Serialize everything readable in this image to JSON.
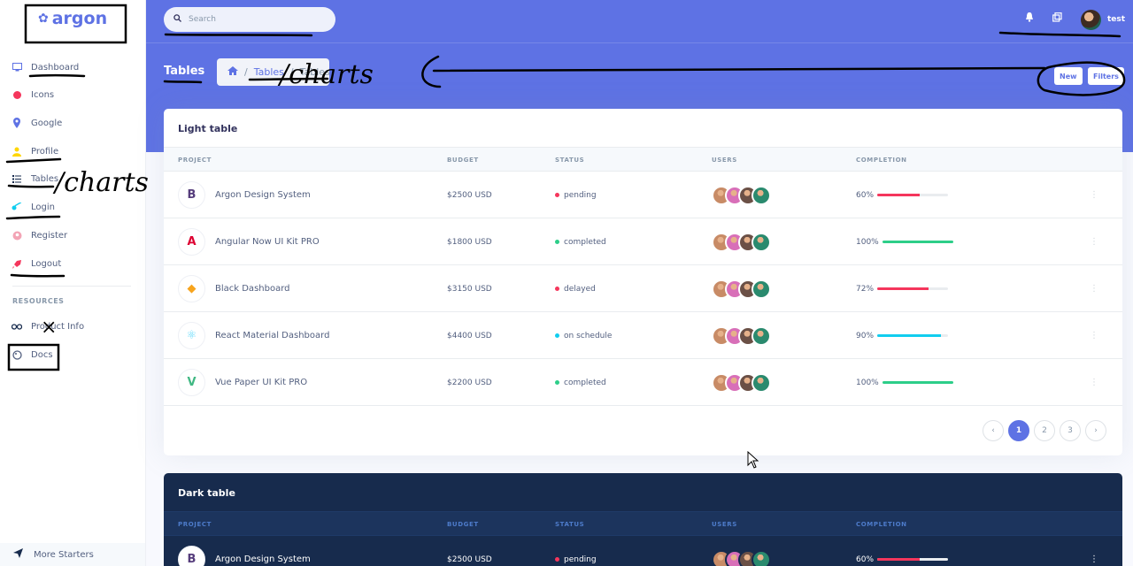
{
  "brand": {
    "name": "argon"
  },
  "sidebar": {
    "items": [
      {
        "label": "Dashboard",
        "icon": "monitor-icon",
        "color": "#5e72e4"
      },
      {
        "label": "Icons",
        "icon": "planet-icon",
        "color": "#f5365c"
      },
      {
        "label": "Google",
        "icon": "pin-icon",
        "color": "#5e72e4"
      },
      {
        "label": "Profile",
        "icon": "user-icon",
        "color": "#ffd600"
      },
      {
        "label": "Tables",
        "icon": "bullet-list-icon",
        "color": "#172b4d"
      },
      {
        "label": "Login",
        "icon": "key-icon",
        "color": "#11cdef"
      },
      {
        "label": "Register",
        "icon": "circle-user-icon",
        "color": "#f3a4b5"
      },
      {
        "label": "Logout",
        "icon": "rocket-icon",
        "color": "#f5365c"
      }
    ],
    "resources_heading": "RESOURCES",
    "resources": [
      {
        "label": "Product Info",
        "icon": "glasses-icon"
      },
      {
        "label": "Docs",
        "icon": "palette-icon"
      }
    ],
    "more_starters": "More Starters"
  },
  "header": {
    "search_placeholder": "Search",
    "user_name": "test",
    "page_title": "Tables",
    "breadcrumb": {
      "sep": "/",
      "link": "Tables",
      "active": "Tables"
    },
    "btn_new": "New",
    "btn_filters": "Filters"
  },
  "light_table": {
    "title": "Light table",
    "columns": [
      "PROJECT",
      "BUDGET",
      "STATUS",
      "USERS",
      "COMPLETION"
    ],
    "rows": [
      {
        "logo": "B",
        "logo_color": "#563d7c",
        "project": "Argon Design System",
        "budget": "$2500 USD",
        "status": "pending",
        "status_color": "#f5365c",
        "completion_label": "60%",
        "completion": 0.6,
        "bar_color": "#f5365c"
      },
      {
        "logo": "A",
        "logo_color": "#dd0031",
        "project": "Angular Now UI Kit PRO",
        "budget": "$1800 USD",
        "status": "completed",
        "status_color": "#2dce89",
        "completion_label": "100%",
        "completion": 1.0,
        "bar_color": "#2dce89"
      },
      {
        "logo": "◆",
        "logo_color": "#f7a41d",
        "project": "Black Dashboard",
        "budget": "$3150 USD",
        "status": "delayed",
        "status_color": "#f5365c",
        "completion_label": "72%",
        "completion": 0.72,
        "bar_color": "#f5365c"
      },
      {
        "logo": "⚛",
        "logo_color": "#61dafb",
        "project": "React Material Dashboard",
        "budget": "$4400 USD",
        "status": "on schedule",
        "status_color": "#11cdef",
        "completion_label": "90%",
        "completion": 0.9,
        "bar_color": "#11cdef"
      },
      {
        "logo": "V",
        "logo_color": "#41b883",
        "project": "Vue Paper UI Kit PRO",
        "budget": "$2200 USD",
        "status": "completed",
        "status_color": "#2dce89",
        "completion_label": "100%",
        "completion": 1.0,
        "bar_color": "#2dce89"
      }
    ],
    "pagination": {
      "prev": "‹",
      "pages": [
        "1",
        "2",
        "3"
      ],
      "next": "›"
    }
  },
  "dark_table": {
    "title": "Dark table",
    "columns": [
      "PROJECT",
      "BUDGET",
      "STATUS",
      "USERS",
      "COMPLETION"
    ],
    "rows": [
      {
        "logo": "B",
        "logo_color": "#563d7c",
        "project": "Argon Design System",
        "budget": "$2500 USD",
        "status": "pending",
        "status_color": "#f5365c",
        "completion_label": "60%",
        "completion": 0.6,
        "bar_color": "#f5365c"
      }
    ]
  },
  "annotations": {
    "breadcrumb_note": "/charts",
    "sidebar_note": "/charts",
    "close_mark": "×"
  }
}
